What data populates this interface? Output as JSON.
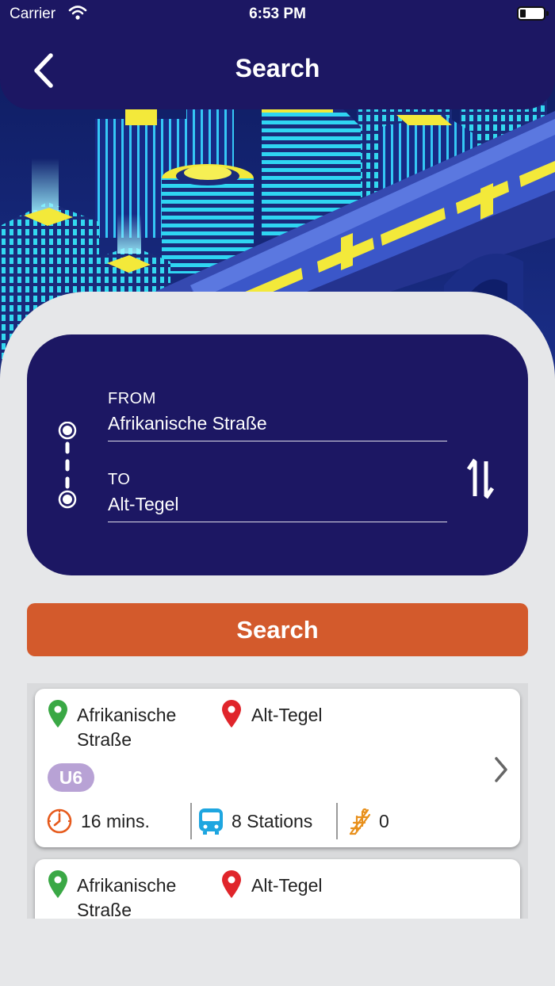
{
  "status_bar": {
    "carrier": "Carrier",
    "time": "6:53 PM"
  },
  "header": {
    "title": "Search",
    "back_icon": "chevron-left-icon"
  },
  "route": {
    "from_label": "FROM",
    "from_value": "Afrikanische Straße",
    "to_label": "TO",
    "to_value": "Alt-Tegel",
    "swap_icon": "swap-vertical-icon"
  },
  "search_button": {
    "label": "Search"
  },
  "results": [
    {
      "from": "Afrikanische Straße",
      "to": "Alt-Tegel",
      "line": "U6",
      "duration": "16 mins.",
      "stations": "8 Stations",
      "transfers": "0"
    },
    {
      "from": "Afrikanische Straße",
      "to": "Alt-Tegel"
    }
  ],
  "colors": {
    "navy": "#1c1763",
    "accent_orange": "#d35a2c",
    "line_u6": "#b8a2d5",
    "pin_from": "#3aa845",
    "pin_to": "#e0252b",
    "station_icon": "#1ea6e0",
    "background": "#e6e7e9"
  }
}
